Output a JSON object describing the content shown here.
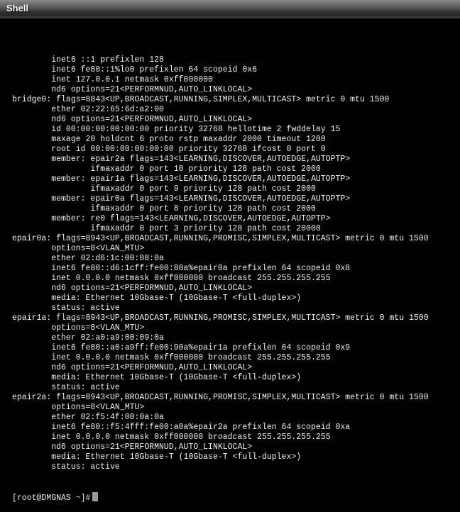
{
  "window": {
    "title": "Shell"
  },
  "terminal": {
    "lines": [
      "        inet6 ::1 prefixlen 128",
      "        inet6 fe80::1%lo0 prefixlen 64 scopeid 0x6",
      "        inet 127.0.0.1 netmask 0xff000000",
      "        nd6 options=21<PERFORMNUD,AUTO_LINKLOCAL>",
      "bridge0: flags=8843<UP,BROADCAST,RUNNING,SIMPLEX,MULTICAST> metric 0 mtu 1500",
      "        ether 02:22:65:6d:a2:00",
      "        nd6 options=21<PERFORMNUD,AUTO_LINKLOCAL>",
      "        id 00:00:00:00:00:00 priority 32768 hellotime 2 fwddelay 15",
      "        maxage 20 holdcnt 6 proto rstp maxaddr 2000 timeout 1200",
      "        root id 00:00:00:00:00:00 priority 32768 ifcost 0 port 0",
      "        member: epair2a flags=143<LEARNING,DISCOVER,AUTOEDGE,AUTOPTP>",
      "                ifmaxaddr 0 port 10 priority 128 path cost 2000",
      "        member: epair1a flags=143<LEARNING,DISCOVER,AUTOEDGE,AUTOPTP>",
      "                ifmaxaddr 0 port 9 priority 128 path cost 2000",
      "        member: epair0a flags=143<LEARNING,DISCOVER,AUTOEDGE,AUTOPTP>",
      "                ifmaxaddr 0 port 8 priority 128 path cost 2000",
      "        member: re0 flags=143<LEARNING,DISCOVER,AUTOEDGE,AUTOPTP>",
      "                ifmaxaddr 0 port 3 priority 128 path cost 20000",
      "epair0a: flags=8943<UP,BROADCAST,RUNNING,PROMISC,SIMPLEX,MULTICAST> metric 0 mtu 1500",
      "        options=8<VLAN_MTU>",
      "        ether 02:d6:1c:00:08:0a",
      "        inet6 fe80::d6:1cff:fe00:80a%epair0a prefixlen 64 scopeid 0x8",
      "        inet 0.0.0.0 netmask 0xff000000 broadcast 255.255.255.255",
      "        nd6 options=21<PERFORMNUD,AUTO_LINKLOCAL>",
      "        media: Ethernet 10Gbase-T (10Gbase-T <full-duplex>)",
      "        status: active",
      "epair1a: flags=8943<UP,BROADCAST,RUNNING,PROMISC,SIMPLEX,MULTICAST> metric 0 mtu 1500",
      "        options=8<VLAN_MTU>",
      "        ether 02:a0:a9:00:09:0a",
      "        inet6 fe80::a0:a9ff:fe00:90a%epair1a prefixlen 64 scopeid 0x9",
      "        inet 0.0.0.0 netmask 0xff000000 broadcast 255.255.255.255",
      "        nd6 options=21<PERFORMNUD,AUTO_LINKLOCAL>",
      "        media: Ethernet 10Gbase-T (10Gbase-T <full-duplex>)",
      "        status: active",
      "epair2a: flags=8943<UP,BROADCAST,RUNNING,PROMISC,SIMPLEX,MULTICAST> metric 0 mtu 1500",
      "        options=8<VLAN_MTU>",
      "        ether 02:f5:4f:00:0a:0a",
      "        inet6 fe80::f5:4fff:fe00:a0a%epair2a prefixlen 64 scopeid 0xa",
      "        inet 0.0.0.0 netmask 0xff000000 broadcast 255.255.255.255",
      "        nd6 options=21<PERFORMNUD,AUTO_LINKLOCAL>",
      "        media: Ethernet 10Gbase-T (10Gbase-T <full-duplex>)",
      "        status: active"
    ],
    "prompt": "[root@DMGNAS ~]#"
  }
}
